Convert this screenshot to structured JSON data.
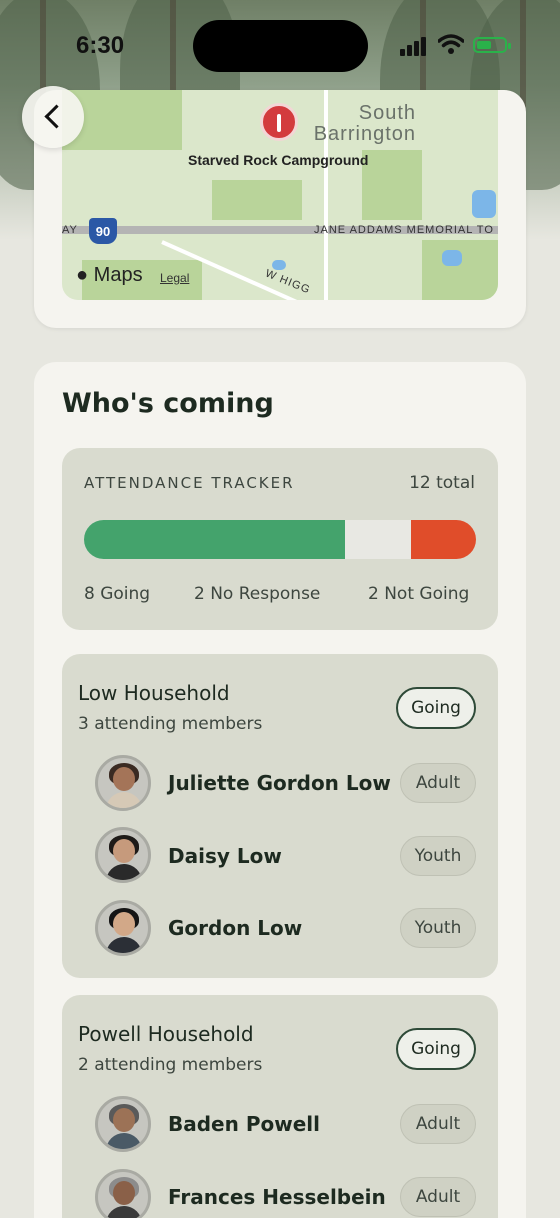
{
  "status_bar": {
    "time": "6:30"
  },
  "map": {
    "place": "South Barrington",
    "pin_label": "Starved Rock Campground",
    "interstate": "90",
    "road_left": "AY",
    "road_right": "JANE ADDAMS MEMORIAL TO",
    "road_lower": "W HIGG",
    "provider": "Maps",
    "legal": "Legal"
  },
  "back_button": {
    "icon": "chevron-left-icon"
  },
  "section": {
    "title": "Who's coming"
  },
  "tracker": {
    "label": "ATTENDANCE TRACKER",
    "total": "12 total",
    "going_label": "8 Going",
    "no_response_label": "2 No Response",
    "not_going_label": "2 Not Going",
    "going": 8,
    "no_response": 2,
    "not_going": 2,
    "colors": {
      "going": "#44a36c",
      "no_response": "#e8e8e3",
      "not_going": "#e04d2a"
    }
  },
  "households": [
    {
      "name": "Low Household",
      "subtitle": "3 attending members",
      "status": "Going",
      "members": [
        {
          "name": "Juliette Gordon Low",
          "role": "Adult"
        },
        {
          "name": "Daisy Low",
          "role": "Youth"
        },
        {
          "name": "Gordon Low",
          "role": "Youth"
        }
      ]
    },
    {
      "name": "Powell Household",
      "subtitle": "2 attending members",
      "status": "Going",
      "members": [
        {
          "name": "Baden Powell",
          "role": "Adult"
        },
        {
          "name": "Frances Hesselbein",
          "role": "Adult"
        }
      ]
    }
  ]
}
